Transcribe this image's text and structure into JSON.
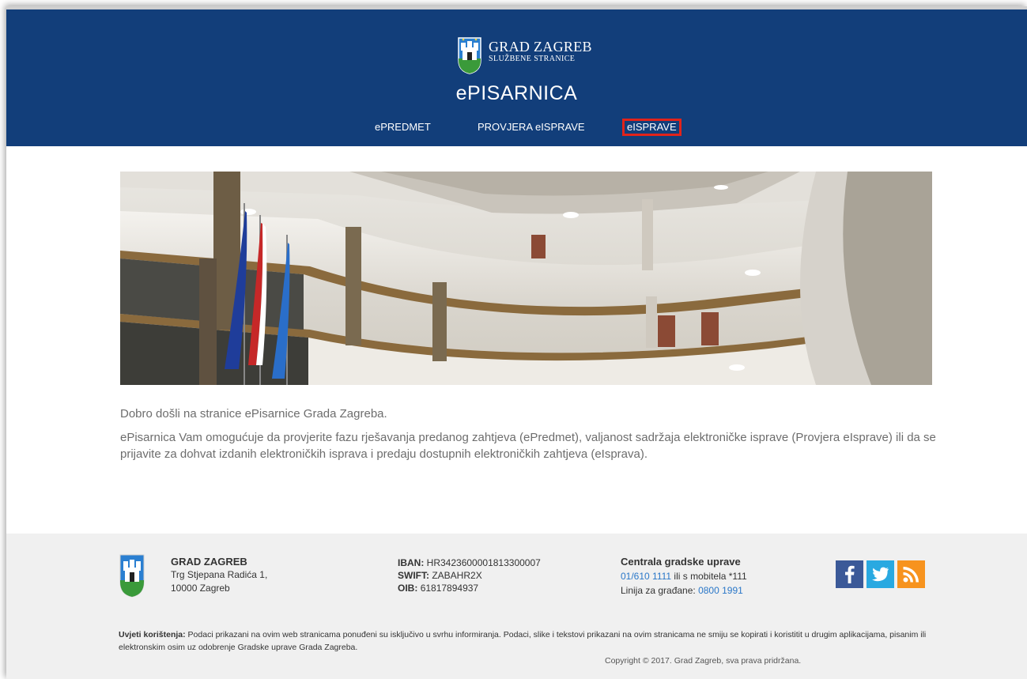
{
  "header": {
    "logo_title": "GRAD ZAGREB",
    "logo_subtitle": "SLUŽBENE STRANICE",
    "app_title": "ePISARNICA",
    "nav": [
      {
        "label": "ePREDMET"
      },
      {
        "label": "PROVJERA eISPRAVE"
      },
      {
        "label": "eISPRAVE",
        "highlighted": true
      }
    ],
    "colors": {
      "header_bg": "#123e7a",
      "highlight_border": "#e2231a"
    }
  },
  "intro": {
    "welcome": "Dobro došli na stranice ePisarnice Grada Zagreba.",
    "description": "ePisarnica Vam omogućuje da provjerite fazu rješavanja predanog zahtjeva (ePredmet), valjanost sadržaja elektroničke isprave (Provjera eIsprave) ili da se prijavite za dohvat izdanih elektroničkih isprava i predaju dostupnih elektroničkih zahtjeva (eIsprava)."
  },
  "footer": {
    "org_name": "GRAD ZAGREB",
    "address_line1": "Trg Stjepana Radića 1,",
    "address_line2": "10000 Zagreb",
    "iban_label": "IBAN:",
    "iban_value": "HR3423600001813300007",
    "swift_label": "SWIFT:",
    "swift_value": "ZABAHR2X",
    "oib_label": "OIB:",
    "oib_value": "61817894937",
    "central_title": "Centrala gradske uprave",
    "central_phone": "01/610 1111",
    "central_mobile_text": " ili s mobitela *111",
    "citizens_line_label": "Linija za građane: ",
    "citizens_line_phone": "0800 1991",
    "social": [
      "facebook-icon",
      "twitter-icon",
      "rss-icon"
    ],
    "terms_label": "Uvjeti korištenja:",
    "terms_text": " Podaci prikazani na ovim web stranicama ponuđeni su isključivo u svrhu informiranja. Podaci, slike i tekstovi prikazani na ovim stranicama ne smiju se kopirati i koristitit u drugim aplikacijama, pisanim ili elektronskim osim uz odobrenje Gradske uprave Grada Zagreba.",
    "copyright": "Copyright © 2017. Grad Zagreb, sva prava pridržana."
  }
}
